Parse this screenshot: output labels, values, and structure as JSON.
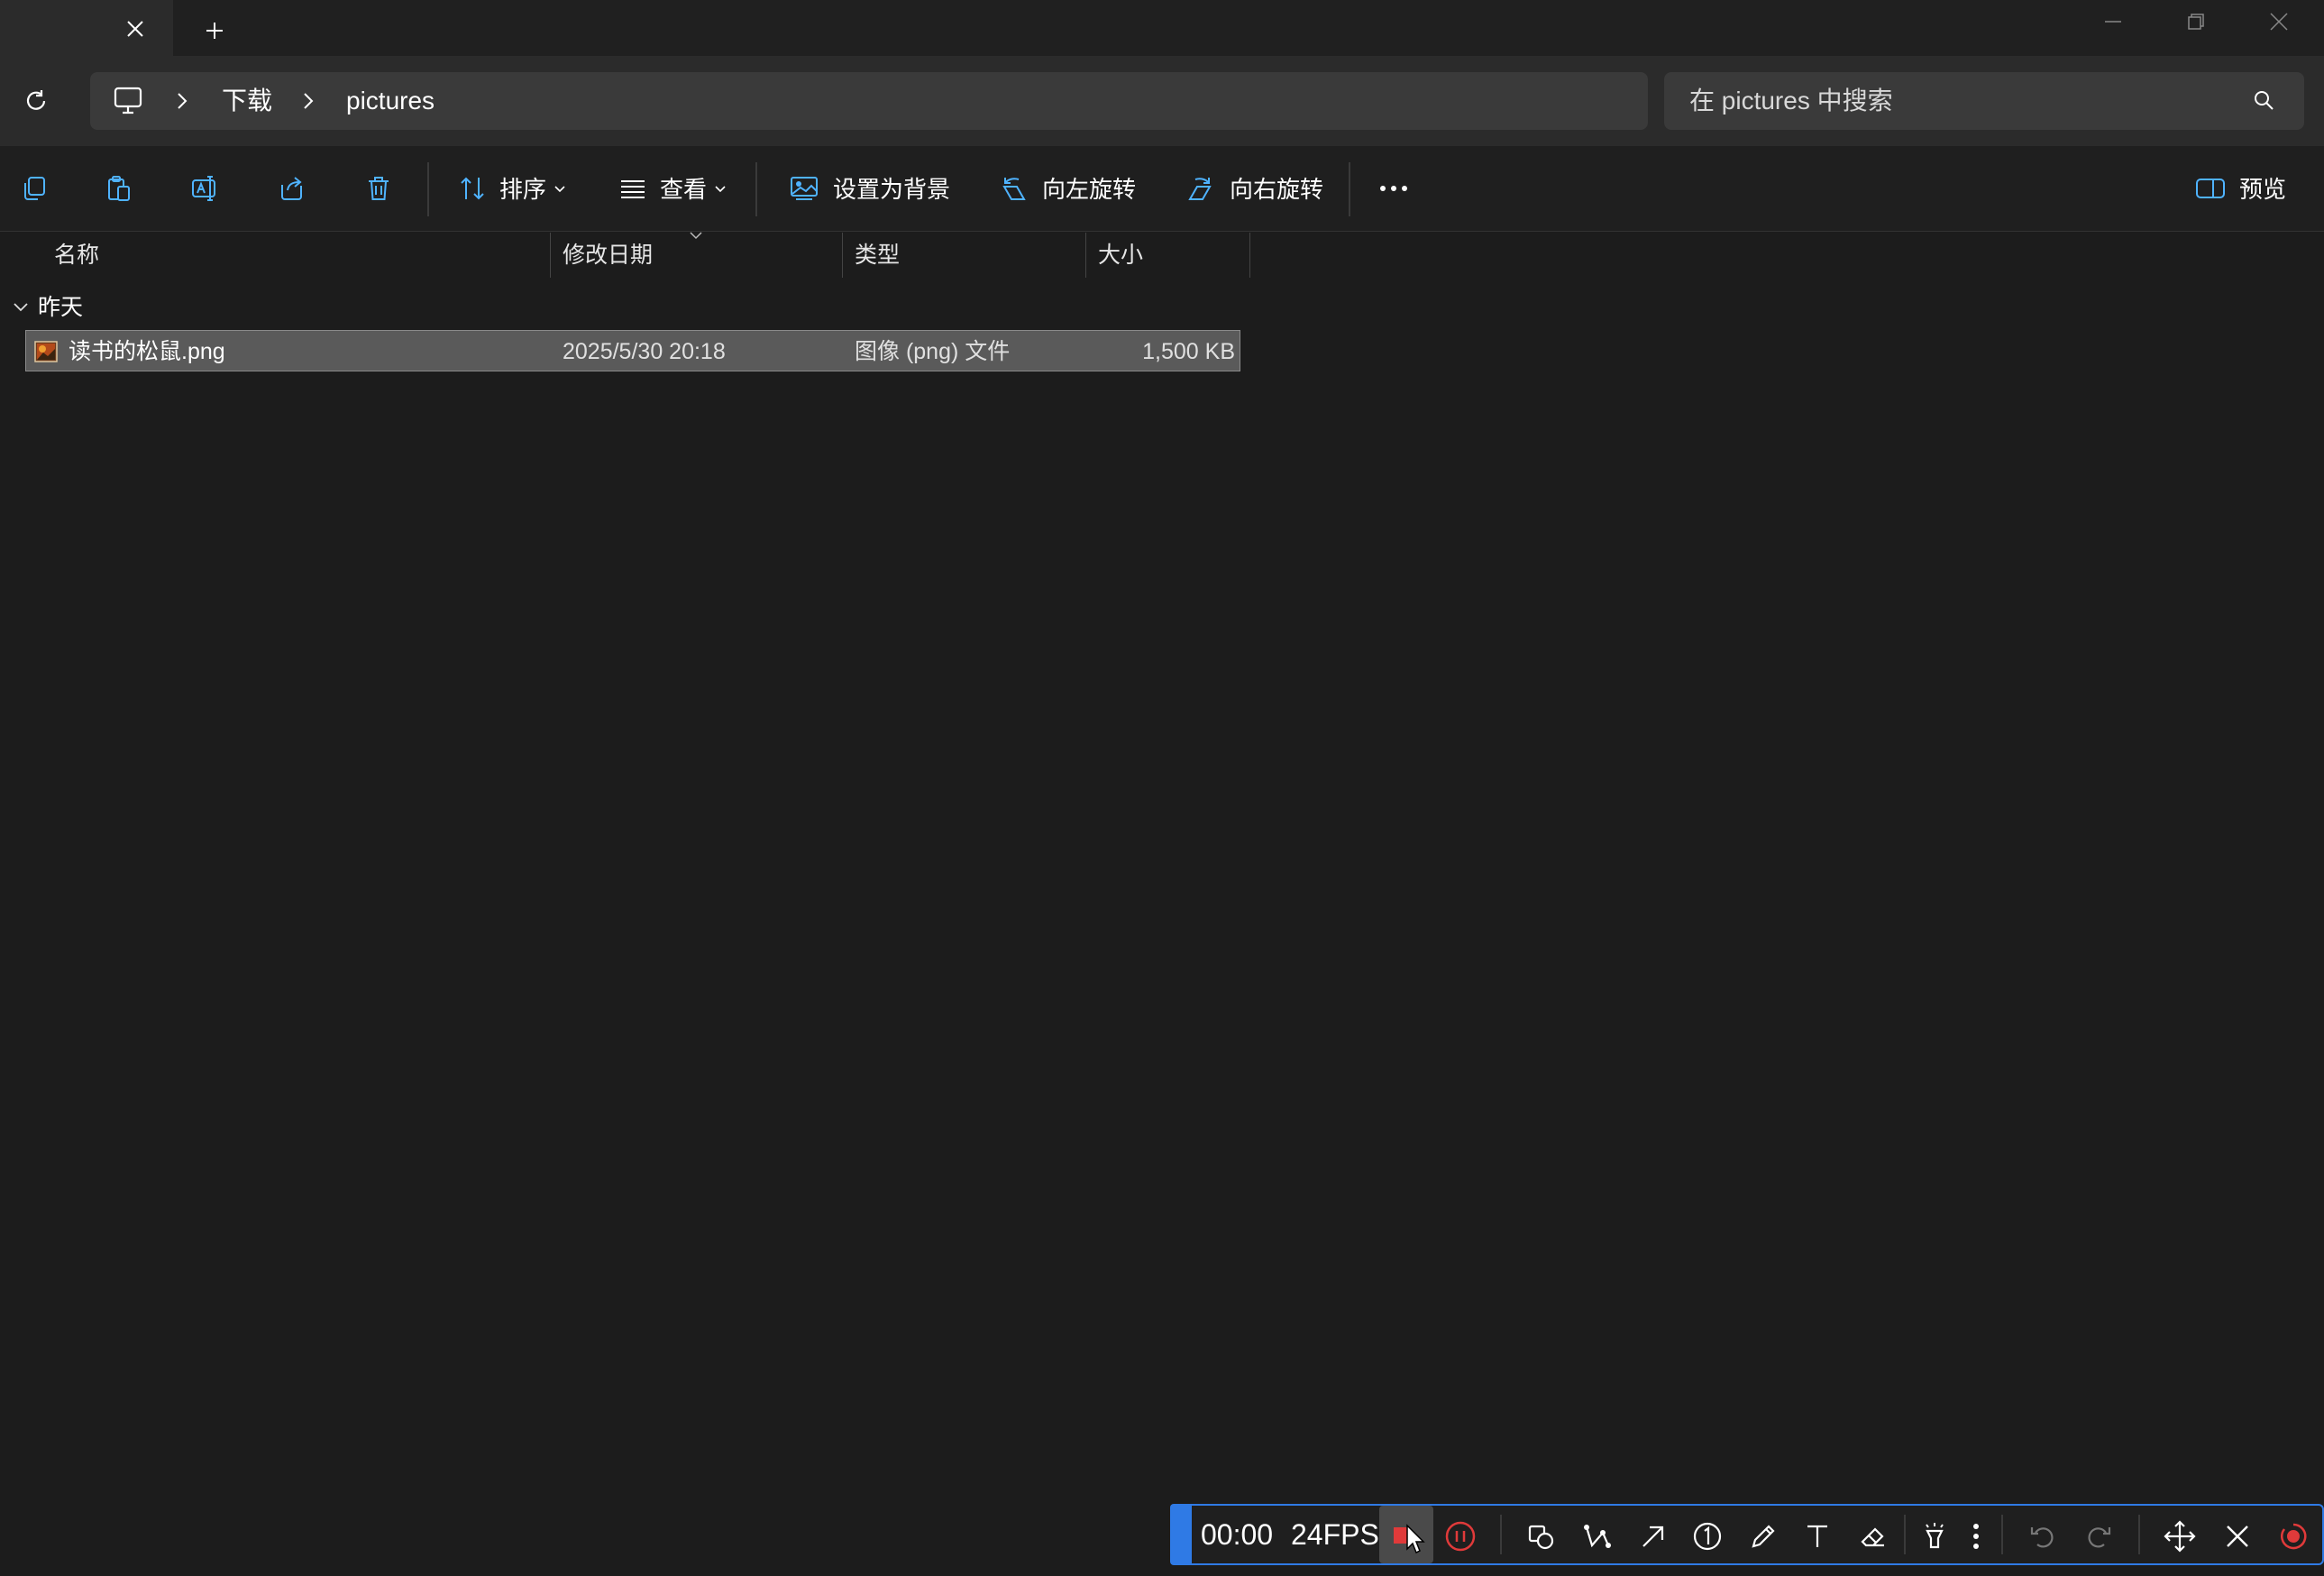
{
  "window": {
    "tab_close_icon": "close-icon",
    "new_tab_icon": "plus-icon"
  },
  "address": {
    "breadcrumb": [
      "下载",
      "pictures"
    ],
    "search_placeholder": "在 pictures 中搜索"
  },
  "commands": {
    "sort_label": "排序",
    "view_label": "查看",
    "set_background_label": "设置为背景",
    "rotate_left_label": "向左旋转",
    "rotate_right_label": "向右旋转",
    "preview_label": "预览"
  },
  "columns": {
    "name": "名称",
    "modified": "修改日期",
    "type": "类型",
    "size": "大小"
  },
  "group": {
    "label": "昨天"
  },
  "files": [
    {
      "name": "读书的松鼠.png",
      "modified": "2025/5/30 20:18",
      "type": "图像 (png) 文件",
      "size": "1,500 KB"
    }
  ],
  "recorder": {
    "time": "00:00",
    "fps": "24FPS"
  },
  "colors": {
    "accent": "#2f7ae5",
    "record_red": "#e03a3a",
    "icon_blue": "#4fb3ff"
  }
}
